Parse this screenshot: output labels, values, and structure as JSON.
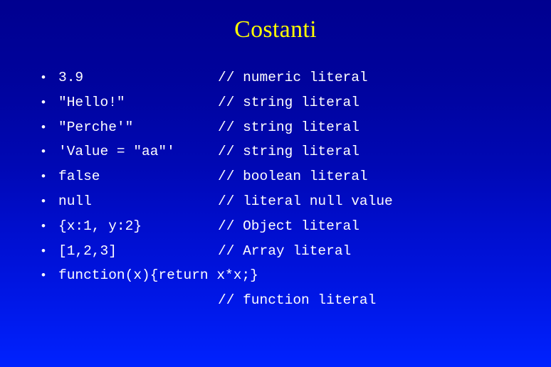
{
  "slide": {
    "title": "Costanti",
    "bullet_marker": "•",
    "colors": {
      "title": "#ffff00",
      "text": "#ffffff",
      "background_top": "#00008f",
      "background_bottom": "#0022ff"
    },
    "items": [
      {
        "code": "3.9",
        "comment": "// numeric literal"
      },
      {
        "code": "\"Hello!\"",
        "comment": "// string literal"
      },
      {
        "code": "\"Perche'\"",
        "comment": "// string literal"
      },
      {
        "code": "'Value = \"aa\"'",
        "comment": "// string literal"
      },
      {
        "code": "false",
        "comment": "// boolean literal"
      },
      {
        "code": "null",
        "comment": "// literal null value"
      },
      {
        "code": "{x:1, y:2}",
        "comment": "// Object literal"
      },
      {
        "code": "[1,2,3]",
        "comment": "// Array literal"
      },
      {
        "code": "function(x){return x*x;}",
        "comment": ""
      }
    ],
    "trailing_comment": "// function literal"
  }
}
